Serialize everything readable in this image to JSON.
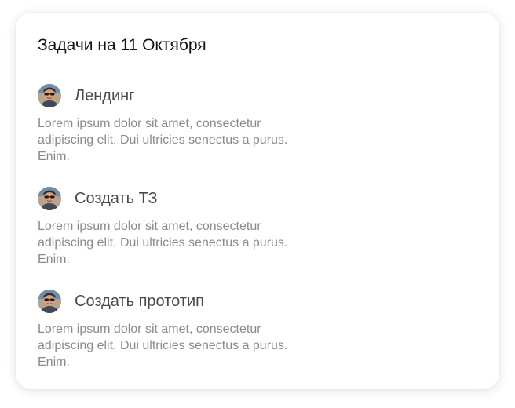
{
  "card": {
    "title": "Задачи на 11 Октября"
  },
  "tasks": [
    {
      "name": "Лендинг",
      "description": "Lorem ipsum dolor sit amet, consectetur adipiscing elit. Dui ultricies senectus a purus. Enim."
    },
    {
      "name": "Создать ТЗ",
      "description": "Lorem ipsum dolor sit amet, consectetur adipiscing elit. Dui ultricies senectus a purus. Enim."
    },
    {
      "name": "Создать прототип",
      "description": "Lorem ipsum dolor sit amet, consectetur adipiscing elit. Dui ultricies senectus a purus. Enim."
    }
  ],
  "colors": {
    "title": "#111111",
    "task_name": "#4a4a4a",
    "task_description": "#8a8a8a",
    "card_background": "#ffffff"
  },
  "icons": {
    "avatar": "user-avatar-photo"
  }
}
